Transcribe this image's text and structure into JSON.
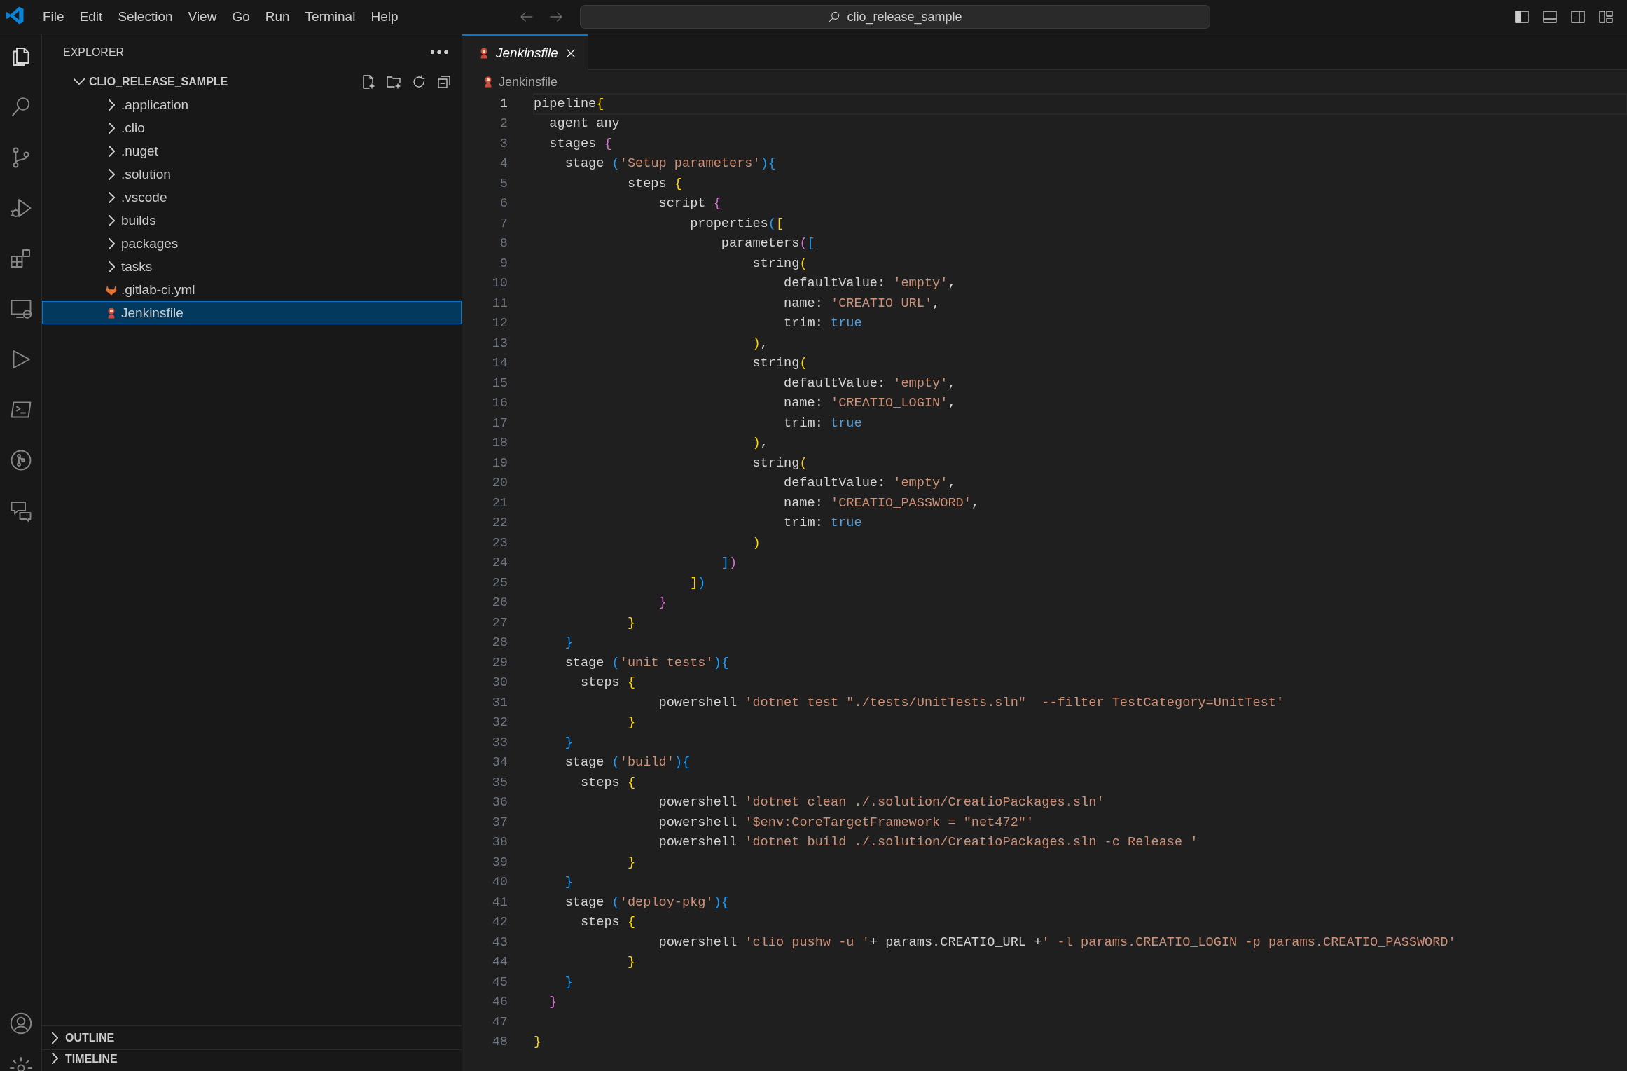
{
  "title_bar": {
    "menu": [
      "File",
      "Edit",
      "Selection",
      "View",
      "Go",
      "Run",
      "Terminal",
      "Help"
    ],
    "command_center": "clio_release_sample"
  },
  "activity_bar": {
    "top": [
      {
        "kind": "files",
        "selected": true
      },
      {
        "kind": "search",
        "selected": false
      },
      {
        "kind": "branch",
        "selected": false
      },
      {
        "kind": "debug",
        "selected": false
      },
      {
        "kind": "extensions",
        "selected": false
      },
      {
        "kind": "remote",
        "selected": false
      },
      {
        "kind": "run",
        "selected": false
      },
      {
        "kind": "terminal",
        "selected": false
      },
      {
        "kind": "graph",
        "selected": false
      },
      {
        "kind": "chat",
        "selected": false
      }
    ],
    "bottom": [
      {
        "kind": "account",
        "selected": false
      },
      {
        "kind": "settings",
        "selected": false
      }
    ]
  },
  "sidebar": {
    "title": "EXPLORER",
    "root": {
      "label": "CLIO_RELEASE_SAMPLE",
      "expanded": true,
      "children": [
        {
          "label": ".application",
          "kind": "folder",
          "expanded": false,
          "selected": false
        },
        {
          "label": ".clio",
          "kind": "folder",
          "expanded": false,
          "selected": false
        },
        {
          "label": ".nuget",
          "kind": "folder",
          "expanded": false,
          "selected": false
        },
        {
          "label": ".solution",
          "kind": "folder",
          "expanded": false,
          "selected": false
        },
        {
          "label": ".vscode",
          "kind": "folder",
          "expanded": false,
          "selected": false
        },
        {
          "label": "builds",
          "kind": "folder",
          "expanded": false,
          "selected": false
        },
        {
          "label": "packages",
          "kind": "folder",
          "expanded": false,
          "selected": false
        },
        {
          "label": "tasks",
          "kind": "folder",
          "expanded": false,
          "selected": false
        },
        {
          "label": ".gitlab-ci.yml",
          "kind": "gitlab",
          "selected": false
        },
        {
          "label": "Jenkinsfile",
          "kind": "jenkins",
          "selected": true
        }
      ]
    },
    "sections": [
      {
        "label": "OUTLINE",
        "expanded": false
      },
      {
        "label": "TIMELINE",
        "expanded": false
      }
    ]
  },
  "editor": {
    "tabs": [
      {
        "label": "Jenkinsfile",
        "selected": true,
        "preview": true
      }
    ],
    "breadcrumb": [
      "Jenkinsfile"
    ],
    "lines": [
      {
        "number": "1",
        "current": true,
        "tokens": [
          {
            "text": "pipeline",
            "kind": "plain"
          },
          {
            "text": "{",
            "kind": "bracket1"
          }
        ]
      },
      {
        "number": "2",
        "current": false,
        "tokens": [
          {
            "text": "  agent any",
            "kind": "plain"
          }
        ]
      },
      {
        "number": "3",
        "current": false,
        "tokens": [
          {
            "text": "  stages ",
            "kind": "plain"
          },
          {
            "text": "{",
            "kind": "bracket2"
          }
        ]
      },
      {
        "number": "4",
        "current": false,
        "tokens": [
          {
            "text": "    stage ",
            "kind": "plain"
          },
          {
            "text": "(",
            "kind": "bracket3"
          },
          {
            "text": "'Setup parameters'",
            "kind": "string"
          },
          {
            "text": "){",
            "kind": "bracket3"
          }
        ]
      },
      {
        "number": "5",
        "current": false,
        "tokens": [
          {
            "text": "            steps ",
            "kind": "plain"
          },
          {
            "text": "{",
            "kind": "bracket1"
          }
        ]
      },
      {
        "number": "6",
        "current": false,
        "tokens": [
          {
            "text": "                script ",
            "kind": "plain"
          },
          {
            "text": "{",
            "kind": "bracket2"
          }
        ]
      },
      {
        "number": "7",
        "current": false,
        "tokens": [
          {
            "text": "                    properties",
            "kind": "plain"
          },
          {
            "text": "(",
            "kind": "bracket3"
          },
          {
            "text": "[",
            "kind": "bracket1"
          }
        ]
      },
      {
        "number": "8",
        "current": false,
        "tokens": [
          {
            "text": "                        parameters",
            "kind": "plain"
          },
          {
            "text": "(",
            "kind": "bracket2"
          },
          {
            "text": "[",
            "kind": "bracket3"
          }
        ]
      },
      {
        "number": "9",
        "current": false,
        "tokens": [
          {
            "text": "                            string",
            "kind": "plain"
          },
          {
            "text": "(",
            "kind": "bracket1"
          }
        ]
      },
      {
        "number": "10",
        "current": false,
        "tokens": [
          {
            "text": "                                defaultValue: ",
            "kind": "plain"
          },
          {
            "text": "'empty'",
            "kind": "string"
          },
          {
            "text": ",",
            "kind": "plain"
          }
        ]
      },
      {
        "number": "11",
        "current": false,
        "tokens": [
          {
            "text": "                                name: ",
            "kind": "plain"
          },
          {
            "text": "'CREATIO_URL'",
            "kind": "string"
          },
          {
            "text": ",",
            "kind": "plain"
          }
        ]
      },
      {
        "number": "12",
        "current": false,
        "tokens": [
          {
            "text": "                                trim: ",
            "kind": "plain"
          },
          {
            "text": "true",
            "kind": "literal"
          }
        ]
      },
      {
        "number": "13",
        "current": false,
        "tokens": [
          {
            "text": "                            )",
            "kind": "bracket1"
          },
          {
            "text": ",",
            "kind": "plain"
          }
        ]
      },
      {
        "number": "14",
        "current": false,
        "tokens": [
          {
            "text": "                            string",
            "kind": "plain"
          },
          {
            "text": "(",
            "kind": "bracket1"
          }
        ]
      },
      {
        "number": "15",
        "current": false,
        "tokens": [
          {
            "text": "                                defaultValue: ",
            "kind": "plain"
          },
          {
            "text": "'empty'",
            "kind": "string"
          },
          {
            "text": ",",
            "kind": "plain"
          }
        ]
      },
      {
        "number": "16",
        "current": false,
        "tokens": [
          {
            "text": "                                name: ",
            "kind": "plain"
          },
          {
            "text": "'CREATIO_LOGIN'",
            "kind": "string"
          },
          {
            "text": ",",
            "kind": "plain"
          }
        ]
      },
      {
        "number": "17",
        "current": false,
        "tokens": [
          {
            "text": "                                trim: ",
            "kind": "plain"
          },
          {
            "text": "true",
            "kind": "literal"
          }
        ]
      },
      {
        "number": "18",
        "current": false,
        "tokens": [
          {
            "text": "                            )",
            "kind": "bracket1"
          },
          {
            "text": ",",
            "kind": "plain"
          }
        ]
      },
      {
        "number": "19",
        "current": false,
        "tokens": [
          {
            "text": "                            string",
            "kind": "plain"
          },
          {
            "text": "(",
            "kind": "bracket1"
          }
        ]
      },
      {
        "number": "20",
        "current": false,
        "tokens": [
          {
            "text": "                                defaultValue: ",
            "kind": "plain"
          },
          {
            "text": "'empty'",
            "kind": "string"
          },
          {
            "text": ",",
            "kind": "plain"
          }
        ]
      },
      {
        "number": "21",
        "current": false,
        "tokens": [
          {
            "text": "                                name: ",
            "kind": "plain"
          },
          {
            "text": "'CREATIO_PASSWORD'",
            "kind": "string"
          },
          {
            "text": ",",
            "kind": "plain"
          }
        ]
      },
      {
        "number": "22",
        "current": false,
        "tokens": [
          {
            "text": "                                trim: ",
            "kind": "plain"
          },
          {
            "text": "true",
            "kind": "literal"
          }
        ]
      },
      {
        "number": "23",
        "current": false,
        "tokens": [
          {
            "text": "                            )",
            "kind": "bracket1"
          }
        ]
      },
      {
        "number": "24",
        "current": false,
        "tokens": [
          {
            "text": "                        ]",
            "kind": "bracket3"
          },
          {
            "text": ")",
            "kind": "bracket2"
          }
        ]
      },
      {
        "number": "25",
        "current": false,
        "tokens": [
          {
            "text": "                    ]",
            "kind": "bracket1"
          },
          {
            "text": ")",
            "kind": "bracket3"
          }
        ]
      },
      {
        "number": "26",
        "current": false,
        "tokens": [
          {
            "text": "                }",
            "kind": "bracket2"
          }
        ]
      },
      {
        "number": "27",
        "current": false,
        "tokens": [
          {
            "text": "            }",
            "kind": "bracket1"
          }
        ]
      },
      {
        "number": "28",
        "current": false,
        "tokens": [
          {
            "text": "    }",
            "kind": "bracket3"
          }
        ]
      },
      {
        "number": "29",
        "current": false,
        "tokens": [
          {
            "text": "    stage ",
            "kind": "plain"
          },
          {
            "text": "(",
            "kind": "bracket3"
          },
          {
            "text": "'unit tests'",
            "kind": "string"
          },
          {
            "text": "){",
            "kind": "bracket3"
          }
        ]
      },
      {
        "number": "30",
        "current": false,
        "tokens": [
          {
            "text": "      steps ",
            "kind": "plain"
          },
          {
            "text": "{",
            "kind": "bracket1"
          }
        ]
      },
      {
        "number": "31",
        "current": false,
        "tokens": [
          {
            "text": "                powershell ",
            "kind": "plain"
          },
          {
            "text": "'dotnet test \"./tests/UnitTests.sln\"  --filter TestCategory=UnitTest'",
            "kind": "string"
          }
        ]
      },
      {
        "number": "32",
        "current": false,
        "tokens": [
          {
            "text": "            }",
            "kind": "bracket1"
          }
        ]
      },
      {
        "number": "33",
        "current": false,
        "tokens": [
          {
            "text": "    }",
            "kind": "bracket3"
          }
        ]
      },
      {
        "number": "34",
        "current": false,
        "tokens": [
          {
            "text": "    stage ",
            "kind": "plain"
          },
          {
            "text": "(",
            "kind": "bracket3"
          },
          {
            "text": "'build'",
            "kind": "string"
          },
          {
            "text": "){",
            "kind": "bracket3"
          }
        ]
      },
      {
        "number": "35",
        "current": false,
        "tokens": [
          {
            "text": "      steps ",
            "kind": "plain"
          },
          {
            "text": "{",
            "kind": "bracket1"
          }
        ]
      },
      {
        "number": "36",
        "current": false,
        "tokens": [
          {
            "text": "                powershell ",
            "kind": "plain"
          },
          {
            "text": "'dotnet clean ./.solution/CreatioPackages.sln'",
            "kind": "string"
          }
        ]
      },
      {
        "number": "37",
        "current": false,
        "tokens": [
          {
            "text": "                powershell ",
            "kind": "plain"
          },
          {
            "text": "'$env:CoreTargetFramework = \"net472\"'",
            "kind": "string"
          }
        ]
      },
      {
        "number": "38",
        "current": false,
        "tokens": [
          {
            "text": "                powershell ",
            "kind": "plain"
          },
          {
            "text": "'dotnet build ./.solution/CreatioPackages.sln -c Release '",
            "kind": "string"
          }
        ]
      },
      {
        "number": "39",
        "current": false,
        "tokens": [
          {
            "text": "            }",
            "kind": "bracket1"
          }
        ]
      },
      {
        "number": "40",
        "current": false,
        "tokens": [
          {
            "text": "    }",
            "kind": "bracket3"
          }
        ]
      },
      {
        "number": "41",
        "current": false,
        "tokens": [
          {
            "text": "    stage ",
            "kind": "plain"
          },
          {
            "text": "(",
            "kind": "bracket3"
          },
          {
            "text": "'deploy-pkg'",
            "kind": "string"
          },
          {
            "text": "){",
            "kind": "bracket3"
          }
        ]
      },
      {
        "number": "42",
        "current": false,
        "tokens": [
          {
            "text": "      steps ",
            "kind": "plain"
          },
          {
            "text": "{",
            "kind": "bracket1"
          }
        ]
      },
      {
        "number": "43",
        "current": false,
        "tokens": [
          {
            "text": "                powershell ",
            "kind": "plain"
          },
          {
            "text": "'clio pushw -u '",
            "kind": "string"
          },
          {
            "text": "+ params.CREATIO_URL +",
            "kind": "plain"
          },
          {
            "text": "' -l params.CREATIO_LOGIN -p params.CREATIO_PASSWORD'",
            "kind": "string"
          }
        ]
      },
      {
        "number": "44",
        "current": false,
        "tokens": [
          {
            "text": "            }",
            "kind": "bracket1"
          }
        ]
      },
      {
        "number": "45",
        "current": false,
        "tokens": [
          {
            "text": "    }",
            "kind": "bracket3"
          }
        ]
      },
      {
        "number": "46",
        "current": false,
        "tokens": [
          {
            "text": "  }",
            "kind": "bracket2"
          }
        ]
      },
      {
        "number": "47",
        "current": false
      },
      {
        "number": "48",
        "current": false,
        "tokens": [
          {
            "text": "}",
            "kind": "bracket1"
          }
        ]
      }
    ]
  }
}
